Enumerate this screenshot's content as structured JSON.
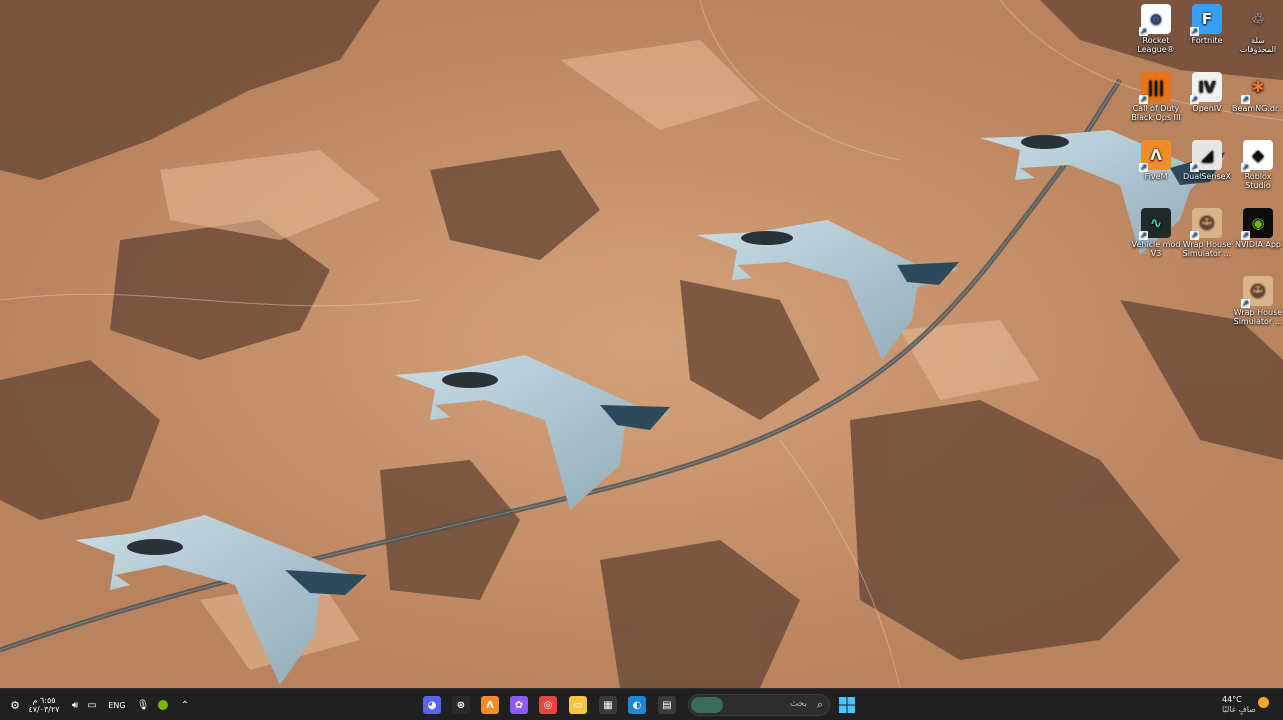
{
  "desktop": {
    "icons": [
      {
        "label": "Rocket\nLeague®",
        "icon": "rocket-league-icon",
        "bg": "#ffffff",
        "fg": "#1a3c8c",
        "glyph": "⊙"
      },
      {
        "label": "Fortnite",
        "icon": "fortnite-icon",
        "bg": "#39a0f0",
        "fg": "#ffffff",
        "glyph": "F"
      },
      {
        "label": "سلة المحذوفات",
        "icon": "recycle-bin-icon",
        "bg": "transparent",
        "fg": "#cfe3f0",
        "glyph": "♲"
      },
      {
        "label": "Call of Duty\nBlack Ops III",
        "icon": "call-of-duty-icon",
        "bg": "#e8741a",
        "fg": "#111111",
        "glyph": "|||"
      },
      {
        "label": "OpenIV",
        "icon": "openiv-icon",
        "bg": "#f2f2f2",
        "fg": "#222222",
        "glyph": "IV"
      },
      {
        "label": "BeamNG.dr...",
        "icon": "beamng-icon",
        "bg": "transparent",
        "fg": "#f07a1a",
        "glyph": "✱"
      },
      {
        "label": "FiveM",
        "icon": "fivem-icon",
        "bg": "#f28c28",
        "fg": "#ffffff",
        "glyph": "Λ"
      },
      {
        "label": "DualSenseX",
        "icon": "dualsensex-icon",
        "bg": "#e6e6e6",
        "fg": "#111111",
        "glyph": "◢"
      },
      {
        "label": "Roblox\nStudio",
        "icon": "roblox-studio-icon",
        "bg": "#ffffff",
        "fg": "#111111",
        "glyph": "◆"
      },
      {
        "label": "Vehicle mod V3",
        "icon": "vehicle-mod-icon",
        "bg": "#1e2a2a",
        "fg": "#39d3a8",
        "glyph": "∿"
      },
      {
        "label": "Wrap House\nSimulator ...",
        "icon": "wrap-house-simulator-icon",
        "bg": "#d9b48a",
        "fg": "#7a3b1a",
        "glyph": "☺"
      },
      {
        "label": "NVIDIA App",
        "icon": "nvidia-app-icon",
        "bg": "#0d0d0d",
        "fg": "#76b900",
        "glyph": "◉"
      },
      {
        "label": "Wrap House\nSimulator ...",
        "icon": "wrap-house-simulator-icon",
        "bg": "#d9b48a",
        "fg": "#7a3b1a",
        "glyph": "☺"
      }
    ]
  },
  "taskbar": {
    "search_placeholder": "بحث",
    "apps": [
      {
        "name": "discord",
        "icon": "discord-icon",
        "bg": "#5865f2",
        "glyph": "◕"
      },
      {
        "name": "steam",
        "icon": "steam-icon",
        "bg": "#2a2a2a",
        "glyph": "⊛"
      },
      {
        "name": "fivem",
        "icon": "fivem-icon",
        "bg": "#f28c28",
        "glyph": "Λ"
      },
      {
        "name": "copilot",
        "icon": "copilot-icon",
        "bg": "#8c5cf0",
        "glyph": "✿"
      },
      {
        "name": "chrome",
        "icon": "chrome-icon",
        "bg": "#e8453c",
        "glyph": "◎"
      },
      {
        "name": "file explorer",
        "icon": "file-explorer-icon",
        "bg": "#f4c542",
        "glyph": "▭"
      },
      {
        "name": "microsoft store",
        "icon": "microsoft-store-icon",
        "bg": "#3a3a3a",
        "glyph": "▦"
      },
      {
        "name": "edge",
        "icon": "edge-icon",
        "bg": "#1a8ad8",
        "glyph": "◐"
      },
      {
        "name": "task view",
        "icon": "task-view-icon",
        "bg": "#3a3a3a",
        "glyph": "▤"
      }
    ],
    "start_icon": "windows-start-icon",
    "tray": {
      "time": "٦:٥٥ م",
      "date": "٤٧/٠٣/٢٧",
      "language": "ENG",
      "weather_temp": "44°C",
      "weather_desc": "صافٍ غالبًا"
    }
  },
  "colors": {
    "taskbar_bg": "#202020",
    "desert_light": "#c8936a",
    "desert_dark": "#6b4a38"
  }
}
